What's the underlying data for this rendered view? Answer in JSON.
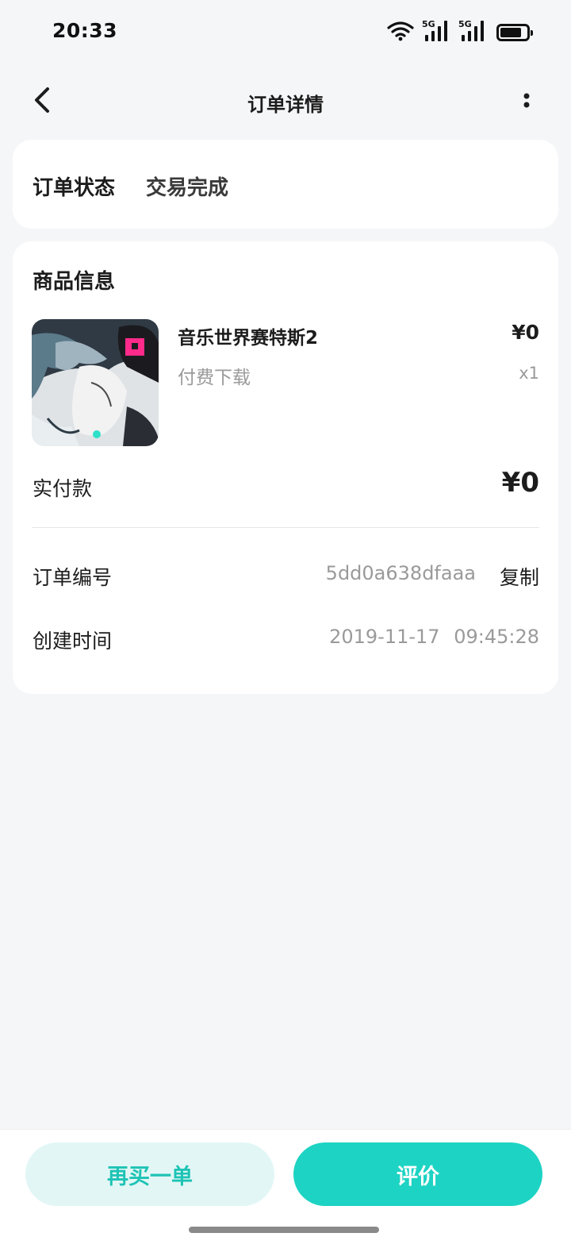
{
  "status_bar": {
    "time": "20:33",
    "network_label_1": "5G",
    "network_label_2": "5G",
    "icons": [
      "wifi-icon",
      "signal-icon",
      "signal-icon",
      "battery-icon"
    ]
  },
  "nav": {
    "title": "订单详情",
    "back_icon": "chevron-left-icon",
    "more_icon": "more-vertical-icon"
  },
  "order_status": {
    "label": "订单状态",
    "value": "交易完成"
  },
  "product_info": {
    "section_title": "商品信息",
    "name": "音乐世界赛特斯2",
    "price": "¥0",
    "type": "付费下载",
    "quantity": "x1",
    "paid_label": "实付款",
    "paid_value": "¥0"
  },
  "order_details": {
    "order_no_label": "订单编号",
    "order_no_value": "5dd0a638dfaaa",
    "copy_label": "复制",
    "created_label": "创建时间",
    "created_value": "2019-11-17 09:45:28"
  },
  "actions": {
    "rebuy_label": "再买一单",
    "review_label": "评价"
  },
  "colors": {
    "accent": "#1dd3c3",
    "accent_light": "#e2f7f5",
    "accent_text": "#1ec3b5",
    "page_bg": "#f5f6f8"
  }
}
